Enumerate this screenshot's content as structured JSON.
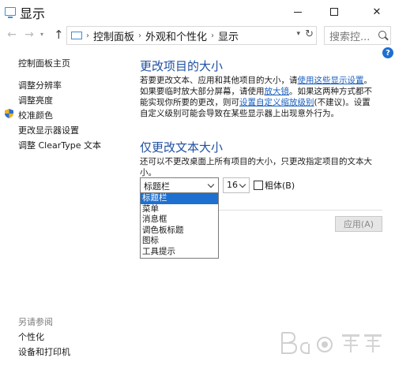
{
  "window": {
    "title": "显示"
  },
  "nav": {
    "breadcrumbs": [
      "控制面板",
      "外观和个性化",
      "显示"
    ]
  },
  "search": {
    "placeholder": "搜索控..."
  },
  "sidebar": {
    "items": [
      "控制面板主页",
      "调整分辨率",
      "调整亮度",
      "校准颜色",
      "更改显示器设置",
      "调整 ClearType 文本"
    ],
    "see_also_label": "另请参阅",
    "see_also": [
      "个性化",
      "设备和打印机"
    ]
  },
  "main": {
    "section1": {
      "heading": "更改项目的大小",
      "p1": "若要更改文本、应用和其他项目的大小，请",
      "link1": "使用这些显示设置",
      "p2": "。如果要临时放大部分屏幕，请使用",
      "link2": "放大镜",
      "p3": "。如果这两种方式都不能实现你所要的更改，则可",
      "link3": "设置自定义缩放级别",
      "p4": "(不建议)。设置自定义级别可能会导致在某些显示器上出现意外行为。"
    },
    "section2": {
      "heading": "仅更改文本大小",
      "desc": "还可以不更改桌面上所有项目的大小，只更改指定项目的文本大小。",
      "item_select_value": "标题栏",
      "size_value": "16",
      "bold_label": "粗体(B)",
      "options": [
        "标题栏",
        "菜单",
        "消息框",
        "调色板标题",
        "图标",
        "工具提示"
      ],
      "apply_label": "应用(A)"
    }
  },
  "watermark": "Bai 经验",
  "colors": {
    "accent": "#1e70d0",
    "heading": "#1f4fa3",
    "link": "#1a5fc0"
  }
}
